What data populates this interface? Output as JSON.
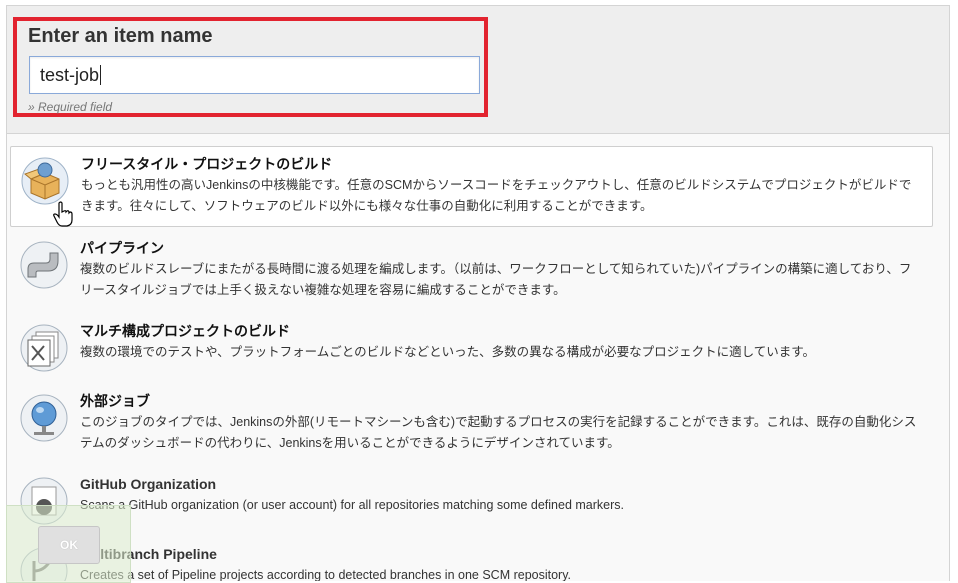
{
  "header": {
    "title": "Enter an item name",
    "input_value": "test-job",
    "required_note": "» Required field"
  },
  "items": [
    {
      "icon": "freestyle-project-icon",
      "title": "フリースタイル・プロジェクトのビルド",
      "desc": "もっとも汎用性の高いJenkinsの中核機能です。任意のSCMからソースコードをチェックアウトし、任意のビルドシステムでプロジェクトがビルドできます。往々にして、ソフトウェアのビルド以外にも様々な仕事の自動化に利用することができます。",
      "selected": true
    },
    {
      "icon": "pipeline-icon",
      "title": "パイプライン",
      "desc": "複数のビルドスレーブにまたがる長時間に渡る処理を編成します。（以前は、ワークフローとして知られていた)パイプラインの構築に適しており、フリースタイルジョブでは上手く扱えない複雑な処理を容易に編成することができます。",
      "selected": false
    },
    {
      "icon": "multi-configuration-icon",
      "title": "マルチ構成プロジェクトのビルド",
      "desc": "複数の環境でのテストや、プラットフォームごとのビルドなどといった、多数の異なる構成が必要なプロジェクトに適しています。",
      "selected": false
    },
    {
      "icon": "external-job-icon",
      "title": "外部ジョブ",
      "desc": "このジョブのタイプでは、Jenkinsの外部(リモートマシーンも含む)で起動するプロセスの実行を記録することができます。これは、既存の自動化システムのダッシュボードの代わりに、Jenkinsを用いることができるようにデザインされています。",
      "selected": false
    },
    {
      "icon": "github-organization-icon",
      "title": "GitHub Organization",
      "desc": "Scans a GitHub organization (or user account) for all repositories matching some defined markers.",
      "selected": false
    },
    {
      "icon": "multibranch-pipeline-icon",
      "title": "Multibranch Pipeline",
      "desc": "Creates a set of Pipeline projects according to detected branches in one SCM repository.",
      "selected": false
    }
  ],
  "footer": {
    "ok_label": "OK"
  }
}
